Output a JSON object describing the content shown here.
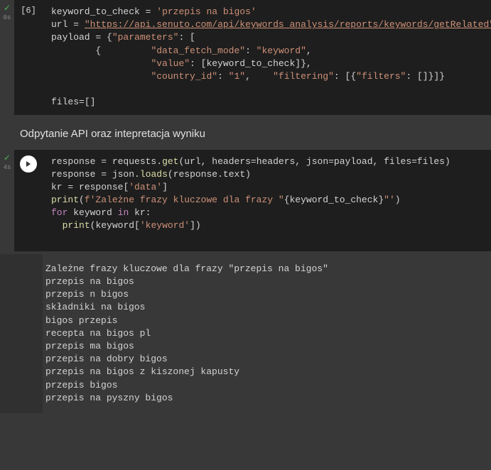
{
  "cell1": {
    "status": "✓",
    "time": "0s",
    "execution_count": "[6]",
    "code": {
      "l1_var": "keyword_to_check",
      "l1_val": "'przepis na bigos'",
      "l2_var": "url",
      "l2_val": "\"https://api.senuto.com/api/keywords_analysis/reports/keywords/getRelated\"",
      "l3_var": "payload",
      "l3_open": " = {",
      "l3_key": "\"parameters\"",
      "l3_rest": ": [",
      "l4_open": "        {",
      "l4_key": "\"data_fetch_mode\"",
      "l4_val": "\"keyword\"",
      "l5_key": "\"value\"",
      "l5_mid": ": [",
      "l5_var": "keyword_to_check",
      "l5_close": "]},",
      "l6_key1": "\"country_id\"",
      "l6_val1": "\"1\"",
      "l6_key2": "\"filtering\"",
      "l6_key3": "\"filters\"",
      "l7_var": "files",
      "l7_val": "=[]"
    }
  },
  "heading": "Odpytanie API oraz intepretacja wyniku",
  "cell2": {
    "status": "✓",
    "time": "4s",
    "code": {
      "l1": {
        "var": "response",
        "fn": "requests",
        "method": "get",
        "args": "url, headers=headers, json=payload, files=files"
      },
      "l2": {
        "var": "response",
        "fn": "json",
        "method": "loads",
        "inner": "response",
        "attr": "text"
      },
      "l3": {
        "var": "kr",
        "src": "response",
        "key": "'data'"
      },
      "l4": {
        "fn": "print",
        "prefix": "f'Zależne frazy kluczowe dla frazy \"",
        "var": "keyword_to_check",
        "suffix": "\"'"
      },
      "l5": {
        "kw1": "for",
        "var": "keyword",
        "kw2": "in",
        "iter": "kr"
      },
      "l6": {
        "fn": "print",
        "obj": "keyword",
        "key": "'keyword'"
      }
    }
  },
  "output": [
    "Zależne frazy kluczowe dla frazy \"przepis na bigos\"",
    "przepis na bigos",
    "przepis n bigos",
    "składniki na bigos",
    "bigos przepis",
    "recepta na bigos pl",
    "przepis ma bigos",
    "przepis na dobry bigos",
    "przepis na bigos z kiszonej kapusty",
    "przepis bigos",
    "przepis na pyszny bigos"
  ]
}
